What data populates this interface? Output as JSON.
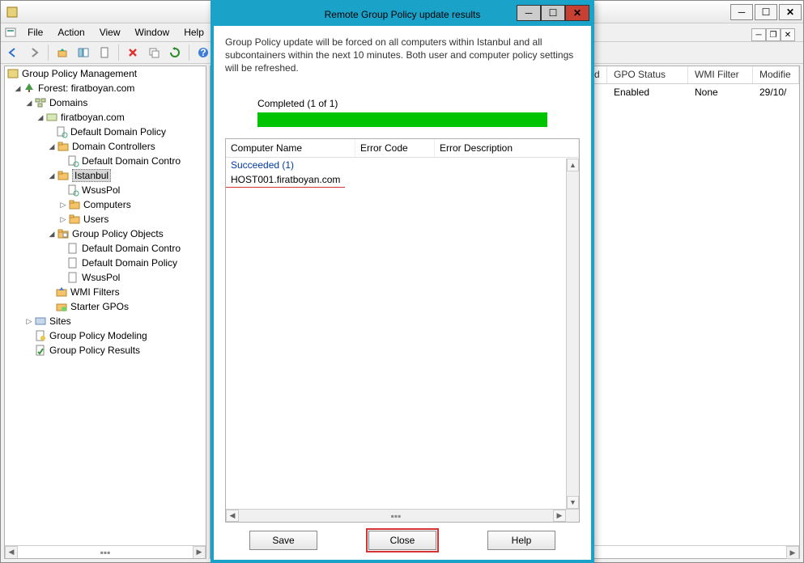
{
  "menubar": {
    "file": "File",
    "action": "Action",
    "view": "View",
    "window": "Window",
    "help": "Help"
  },
  "tree": {
    "root": "Group Policy Management",
    "forest": "Forest: firatboyan.com",
    "domains": "Domains",
    "domain": "firatboyan.com",
    "ddp": "Default Domain Policy",
    "dc": "Domain Controllers",
    "ddcp_trunc": "Default Domain Contro",
    "istanbul": "Istanbul",
    "wsuspol": "WsusPol",
    "computers": "Computers",
    "users": "Users",
    "gpo": "Group Policy Objects",
    "gpo_ddc": "Default Domain Contro",
    "gpo_ddp": "Default Domain Policy",
    "gpo_wsus": "WsusPol",
    "wmi": "WMI Filters",
    "starter": "Starter GPOs",
    "sites": "Sites",
    "modeling": "Group Policy Modeling",
    "results": "Group Policy Results"
  },
  "right": {
    "hdr_enabled": "bled",
    "hdr_gpostatus": "GPO Status",
    "hdr_wmi": "WMI Filter",
    "hdr_modified": "Modifie",
    "row_enabled": "Enabled",
    "row_wmi": "None",
    "row_mod": "29/10/"
  },
  "dialog": {
    "title": "Remote Group Policy update results",
    "desc": "Group Policy update will be forced on all computers within Istanbul and all subcontainers within the next 10 minutes. Both user and computer policy settings will be refreshed.",
    "completed": "Completed (1 of 1)",
    "col_computer": "Computer Name",
    "col_errcode": "Error Code",
    "col_errdesc": "Error Description",
    "group": "Succeeded (1)",
    "item": "HOST001.firatboyan.com",
    "btn_save": "Save",
    "btn_close": "Close",
    "btn_help": "Help"
  }
}
